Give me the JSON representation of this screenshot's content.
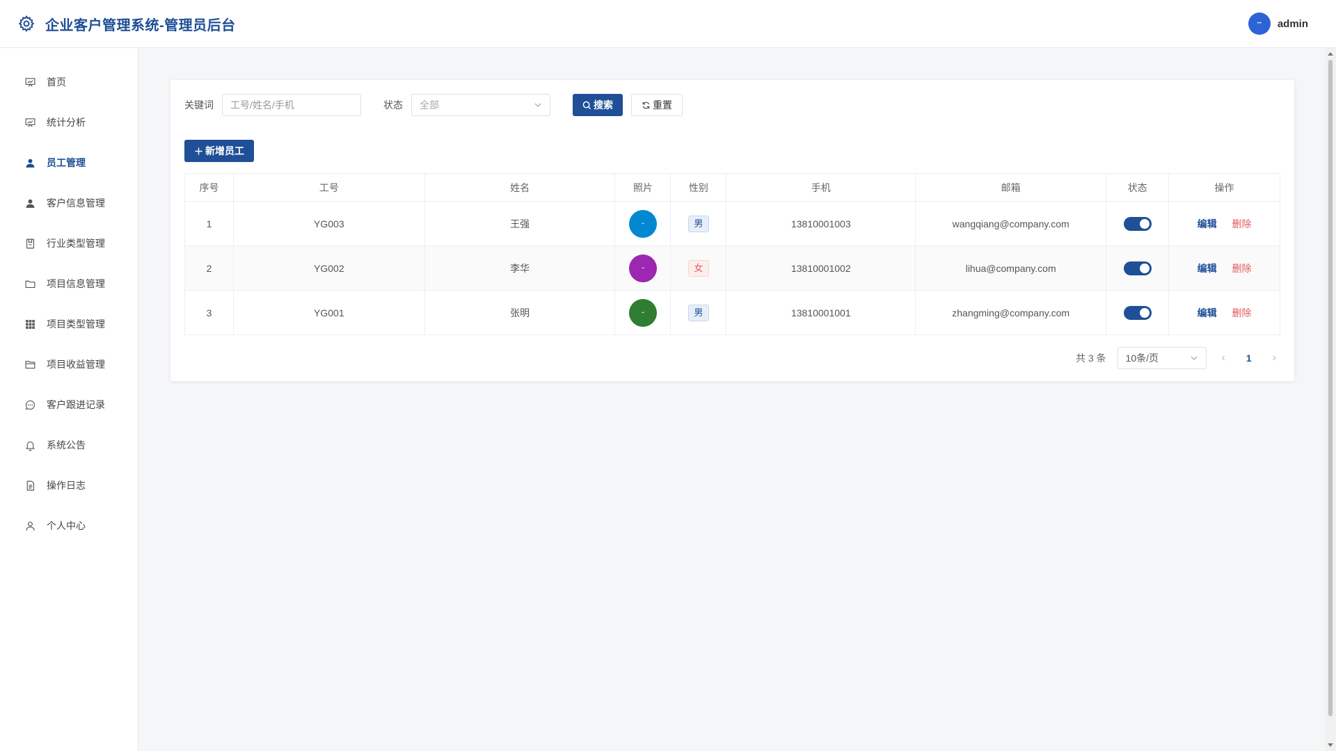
{
  "app": {
    "title": "企业客户管理系统-管理员后台",
    "user": "admin"
  },
  "sidebar": {
    "items": [
      {
        "label": "首页",
        "icon": "chart-board-icon",
        "active": false
      },
      {
        "label": "统计分析",
        "icon": "chart-board-icon",
        "active": false
      },
      {
        "label": "员工管理",
        "icon": "user-icon",
        "active": true
      },
      {
        "label": "客户信息管理",
        "icon": "user-icon",
        "active": false
      },
      {
        "label": "行业类型管理",
        "icon": "box-icon",
        "active": false
      },
      {
        "label": "项目信息管理",
        "icon": "folder-icon",
        "active": false
      },
      {
        "label": "项目类型管理",
        "icon": "grid-icon",
        "active": false
      },
      {
        "label": "项目收益管理",
        "icon": "folder-open-icon",
        "active": false
      },
      {
        "label": "客户跟进记录",
        "icon": "chat-icon",
        "active": false
      },
      {
        "label": "系统公告",
        "icon": "bell-icon",
        "active": false
      },
      {
        "label": "操作日志",
        "icon": "document-icon",
        "active": false
      },
      {
        "label": "个人中心",
        "icon": "user-outline-icon",
        "active": false
      }
    ]
  },
  "filter": {
    "keyword_label": "关键词",
    "keyword_placeholder": "工号/姓名/手机",
    "status_label": "状态",
    "status_value": "全部",
    "search_label": "搜索",
    "reset_label": "重置"
  },
  "actions": {
    "add_label": "新增员工"
  },
  "table": {
    "columns": [
      "序号",
      "工号",
      "姓名",
      "照片",
      "性别",
      "手机",
      "邮箱",
      "状态",
      "操作"
    ],
    "rows": [
      {
        "index": "1",
        "emp_id": "YG003",
        "name": "王强",
        "gender": "男",
        "phone": "13810001003",
        "email": "wangqiang@company.com",
        "photo_color": "#0288d1",
        "enabled": true
      },
      {
        "index": "2",
        "emp_id": "YG002",
        "name": "李华",
        "gender": "女",
        "phone": "13810001002",
        "email": "lihua@company.com",
        "photo_color": "#9c27b0",
        "enabled": true
      },
      {
        "index": "3",
        "emp_id": "YG001",
        "name": "张明",
        "gender": "男",
        "phone": "13810001001",
        "email": "zhangming@company.com",
        "photo_color": "#2e7d32",
        "enabled": true
      }
    ],
    "edit_label": "编辑",
    "delete_label": "删除"
  },
  "pagination": {
    "total_text": "共 3 条",
    "page_size": "10条/页",
    "current_page": "1"
  },
  "colors": {
    "primary": "#1f4f97",
    "danger": "#e25b5b"
  }
}
